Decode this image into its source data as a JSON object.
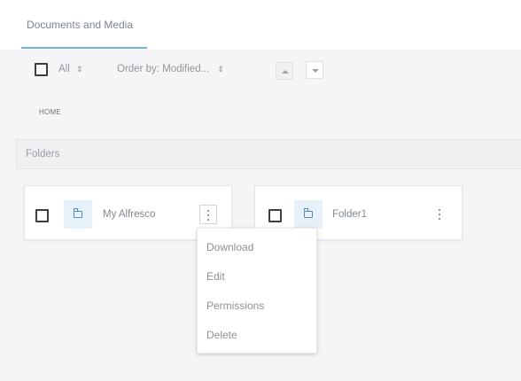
{
  "tabs": {
    "active_label": "Documents and Media"
  },
  "toolbar": {
    "select_all_label": "All",
    "order_by_label": "Order by: Modified...",
    "sort_ascending_icon": "triangle-up-icon",
    "sort_descending_icon": "triangle-down-icon"
  },
  "breadcrumb": {
    "home": "HOME"
  },
  "section": {
    "title": "Folders"
  },
  "folders": [
    {
      "name": "My Alfresco",
      "icon": "folder-icon"
    },
    {
      "name": "Folder1",
      "icon": "folder-icon"
    }
  ],
  "context_menu": {
    "items": [
      "Download",
      "Edit",
      "Permissions",
      "Delete"
    ]
  },
  "colors": {
    "accent_underline": "#6fb4df",
    "folder_tile_bg": "#e6f1fa",
    "folder_icon": "#5b8cb5"
  }
}
